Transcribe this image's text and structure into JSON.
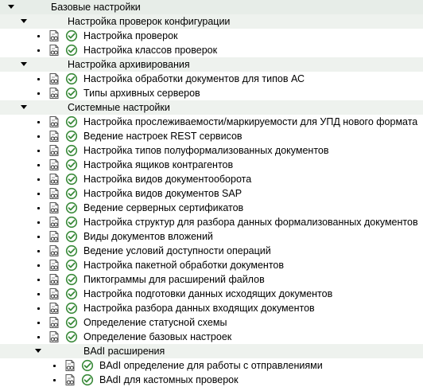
{
  "tree": {
    "root": {
      "label": "Базовые настройки"
    },
    "groups": [
      {
        "label": "Настройка проверок конфигурации",
        "items": [
          "Настройка проверок",
          "Настройка классов проверок"
        ]
      },
      {
        "label": "Настройка архивирования",
        "items": [
          "Настройка обработки документов для типов АС",
          "Типы архивных серверов"
        ]
      },
      {
        "label": "Системные настройки",
        "items": [
          "Настройка прослеживаемости/маркируемости для УПД нового формата",
          "Ведение настроек REST сервисов",
          "Настройка типов полуформализованных документов",
          "Настройка ящиков контрагентов",
          "Настройка видов документооборота",
          "Настройка видов документов SAP",
          "Ведение серверных сертификатов",
          "Настройка структур для разбора данных формализованных документов",
          "Виды документов вложений",
          "Ведение условий доступности операций",
          "Настройка пакетной обработки документов",
          "Пиктограммы для расширений файлов",
          "Настройка подготовки данных исходящих документов",
          "Настройка разбора данных входящих документов",
          "Определение статусной схемы",
          "Определение базовых настроек"
        ],
        "subgroup": {
          "label": "BAdI расширения",
          "items": [
            "BAdI определение для работы с отправлениями",
            "BAdI для кастомных проверок"
          ]
        }
      }
    ]
  },
  "colors": {
    "check_green": "#3a8a3a",
    "folder_bg": "#eef2ee",
    "accent_red": "#d40000"
  },
  "icons": {
    "expanded": "triangle-down-icon",
    "leaf_doc": "document-glasses-icon",
    "leaf_exec": "execute-check-icon"
  }
}
